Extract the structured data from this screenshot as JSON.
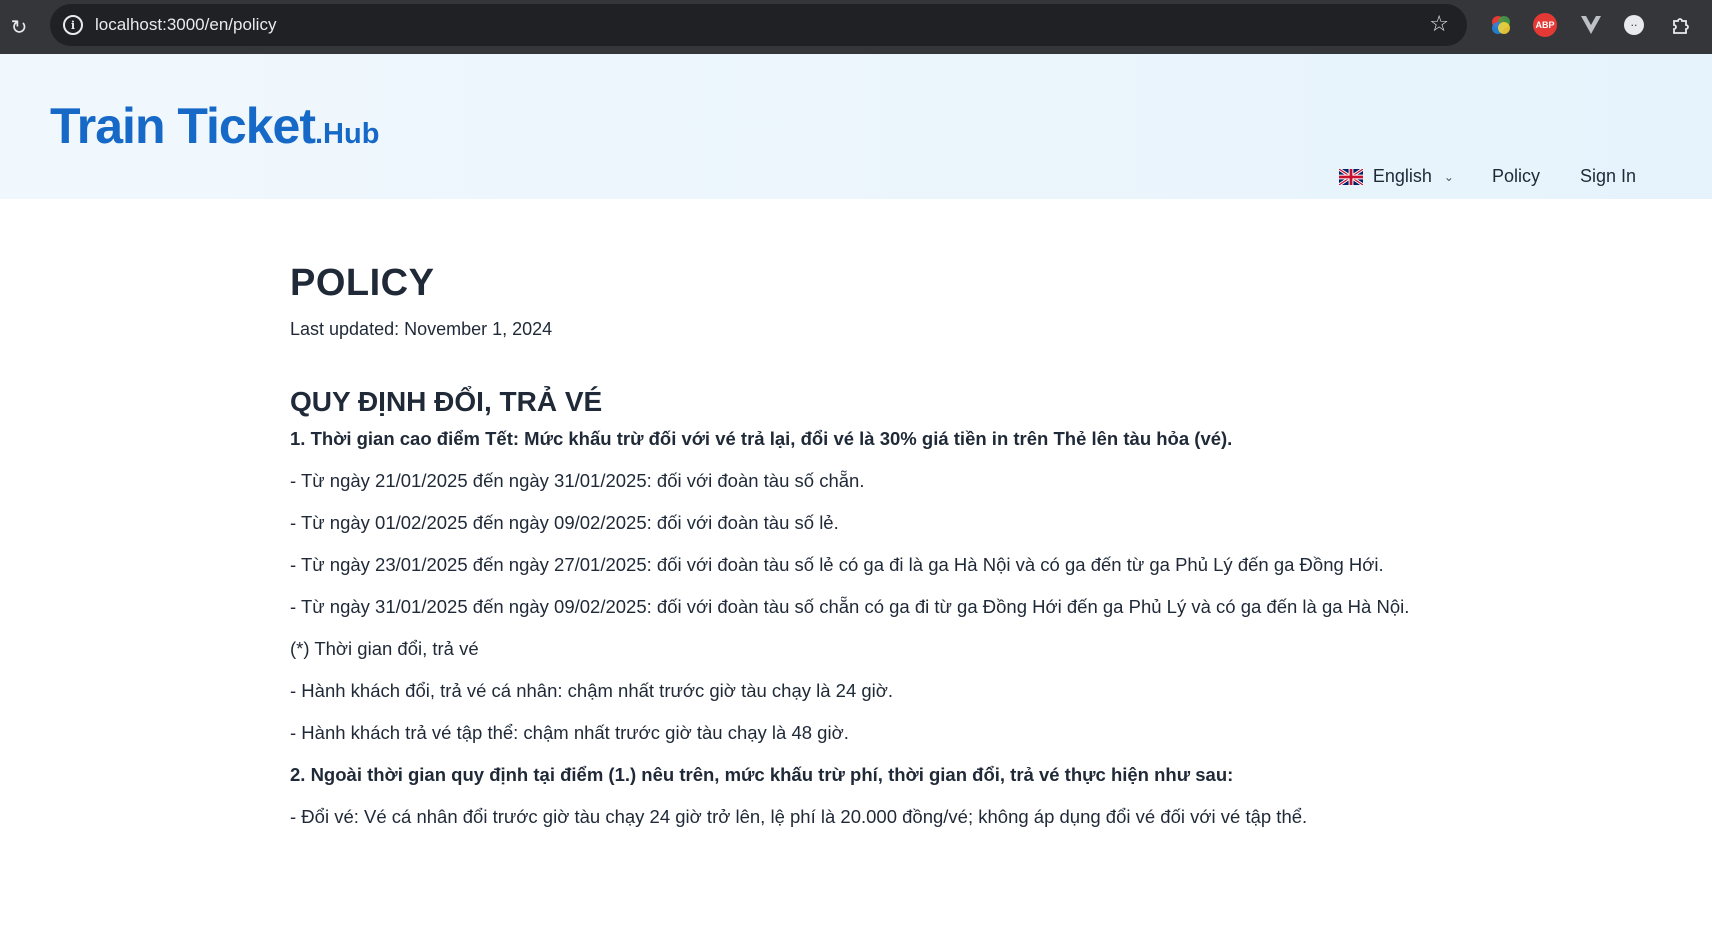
{
  "browser": {
    "url": "localhost:3000/en/policy"
  },
  "header": {
    "logo_main": "Train Ticket",
    "logo_suffix": ".Hub",
    "language": "English",
    "nav_policy": "Policy",
    "nav_signin": "Sign In"
  },
  "content": {
    "title": "POLICY",
    "last_updated": "Last updated: November 1, 2024",
    "section_title": "QUY ĐỊNH ĐỔI, TRẢ VÉ",
    "paragraphs": [
      "1. Thời gian cao điểm Tết: Mức khấu trừ đối với vé trả lại, đổi vé là 30% giá tiền in trên Thẻ lên tàu hỏa (vé).",
      "- Từ ngày 21/01/2025 đến ngày 31/01/2025: đối với đoàn tàu số chẵn.",
      "- Từ ngày 01/02/2025 đến ngày 09/02/2025: đối với đoàn tàu số lẻ.",
      "- Từ ngày 23/01/2025 đến ngày 27/01/2025: đối với đoàn tàu số lẻ có ga đi là ga Hà Nội và có ga đến từ ga Phủ Lý đến ga Đồng Hới.",
      "- Từ ngày 31/01/2025 đến ngày 09/02/2025: đối với đoàn tàu số chẵn có ga đi từ ga Đồng Hới đến ga Phủ Lý và có ga đến là ga Hà Nội.",
      "(*) Thời gian đổi, trả vé",
      "- Hành khách đổi, trả vé cá nhân: chậm nhất trước giờ tàu chạy là 24 giờ.",
      "- Hành khách trả vé tập thể: chậm nhất trước giờ tàu chạy là 48 giờ.",
      "2. Ngoài thời gian quy định tại điểm (1.) nêu trên, mức khấu trừ phí, thời gian đổi, trả vé thực hiện như sau:",
      "- Đổi vé: Vé cá nhân đổi trước giờ tàu chạy 24 giờ trở lên, lệ phí là 20.000 đồng/vé; không áp dụng đổi vé đối với vé tập thể."
    ]
  },
  "colors": {
    "brand": "#1669c7",
    "chrome_bg": "#35363a",
    "omnibox_bg": "#202124",
    "header_bg": "#e6f3fc"
  },
  "icons": [
    "reload-icon",
    "site-info-icon",
    "bookmark-star-icon",
    "color-extension-icon",
    "adblock-plus-icon",
    "vue-devtools-icon",
    "extension-dot-icon",
    "extensions-puzzle-icon",
    "uk-flag-icon",
    "chevron-down-icon"
  ]
}
